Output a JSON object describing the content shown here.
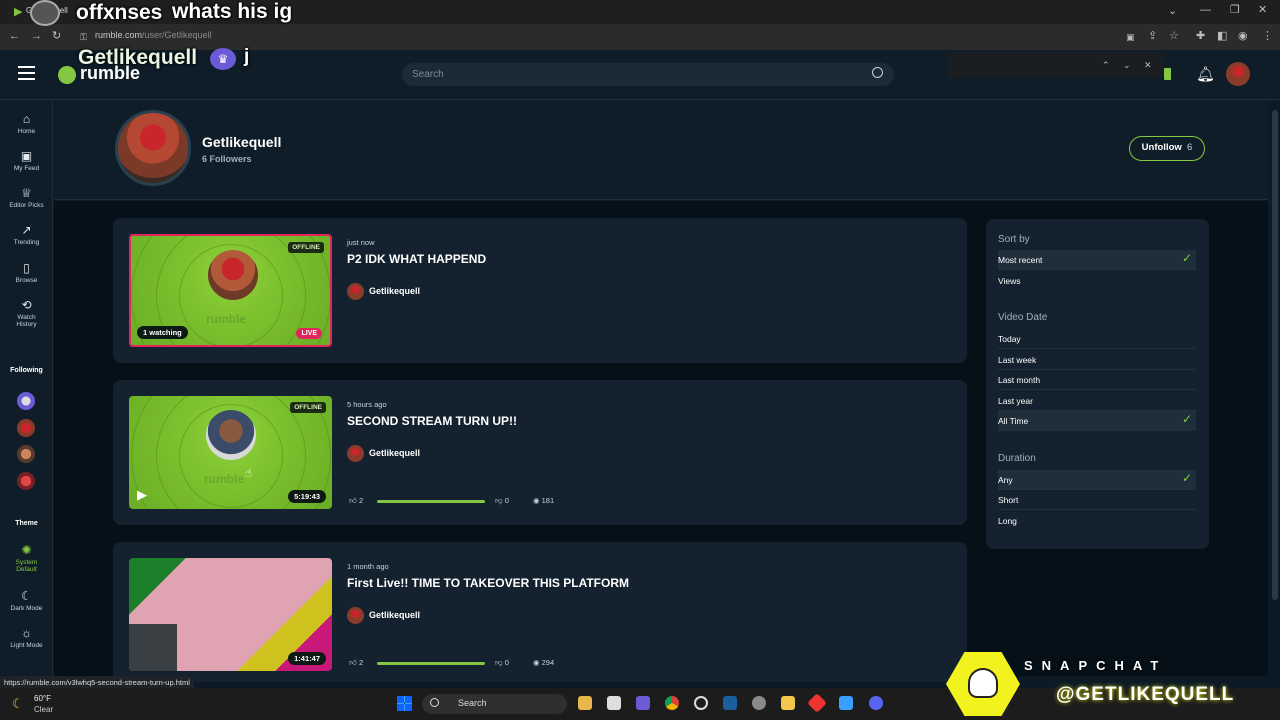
{
  "browser": {
    "tab_title": "Getlikequell",
    "url_domain": "rumble.com",
    "url_path": "/user/Getlikequell"
  },
  "overlay": {
    "top_text_1": "offxnses",
    "top_text_2": "whats his ig",
    "name_text": "Getlikequell",
    "name_suffix": "j"
  },
  "header": {
    "logo": "rumble",
    "search_placeholder": "Search"
  },
  "sidebar": {
    "items": [
      {
        "label": "Home",
        "icon": "home-icon"
      },
      {
        "label": "My Feed",
        "icon": "feed-icon"
      },
      {
        "label": "Editor Picks",
        "icon": "trophy-icon"
      },
      {
        "label": "Trending",
        "icon": "trending-icon"
      },
      {
        "label": "Browse",
        "icon": "browse-icon"
      },
      {
        "label": "Watch",
        "label2": "History",
        "icon": "history-icon"
      }
    ],
    "following_label": "Following",
    "theme_label": "Theme",
    "themes": [
      {
        "label": "System",
        "label2": "Default",
        "icon": "system-theme-icon"
      },
      {
        "label": "Dark Mode",
        "icon": "moon-icon"
      },
      {
        "label": "Light Mode",
        "icon": "sun-icon"
      }
    ]
  },
  "channel": {
    "name": "Getlikequell",
    "followers": "6 Followers",
    "unfollow_label": "Unfollow",
    "unfollow_count": "6"
  },
  "videos": [
    {
      "age": "just now",
      "title": "P2 IDK WHAT HAPPEND",
      "channel": "Getlikequell",
      "badge": "OFFLINE",
      "watching": "1 watching",
      "live": "LIVE",
      "watermark": "rumble"
    },
    {
      "age": "5 hours ago",
      "title": "SECOND STREAM TURN UP!!",
      "channel": "Getlikequell",
      "badge": "OFFLINE",
      "duration": "5:19:43",
      "likes": "2",
      "dislikes": "0",
      "views": "181",
      "watermark": "rumble"
    },
    {
      "age": "1 month ago",
      "title": "First Live!! TIME TO TAKEOVER THIS PLATFORM",
      "channel": "Getlikequell",
      "duration": "1:41:47",
      "likes": "2",
      "dislikes": "0",
      "views": "294"
    }
  ],
  "filters": {
    "sort_by": "Sort by",
    "sort_options": [
      "Most recent",
      "Views"
    ],
    "video_date": "Video Date",
    "date_options": [
      "Today",
      "Last week",
      "Last month",
      "Last year",
      "All Time"
    ],
    "duration": "Duration",
    "duration_options": [
      "Any",
      "Short",
      "Long"
    ]
  },
  "statusbar": {
    "url": "https://rumble.com/v3lwhq5-second-stream-turn-up.html"
  },
  "taskbar": {
    "temp": "60°F",
    "weather": "Clear",
    "search": "Search"
  },
  "snapchat": {
    "label": "SNAPCHAT",
    "handle": "@GETLIKEQUELL"
  },
  "colors": {
    "accent": "#85c742",
    "live": "#e3245d",
    "bg": "#0b1a25"
  }
}
